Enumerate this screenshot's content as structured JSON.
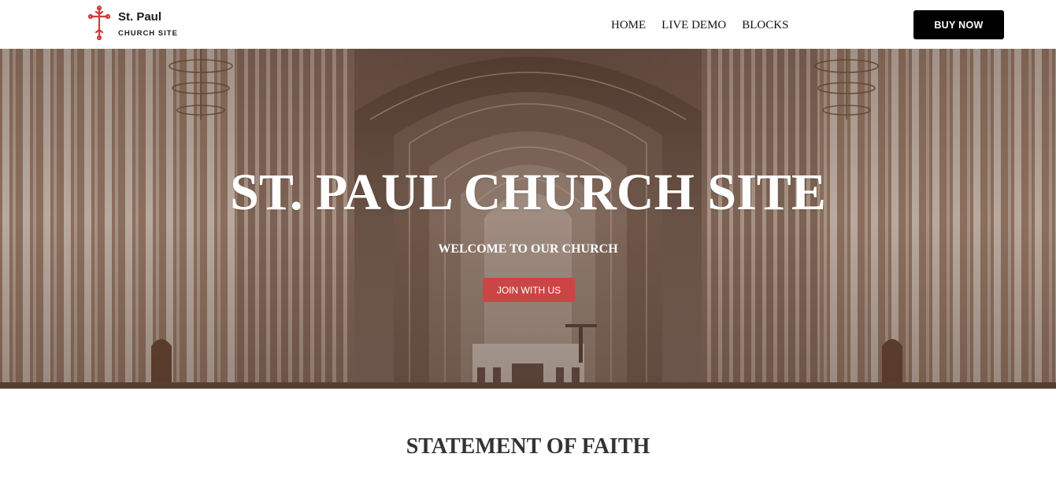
{
  "header": {
    "logo": {
      "name": "St. Paul",
      "subtitle": "CHURCH SITE",
      "icon": "cross-icon",
      "icon_color": "#d0393b"
    },
    "nav": [
      {
        "label": "HOME"
      },
      {
        "label": "LIVE DEMO"
      },
      {
        "label": "BLOCKS"
      }
    ],
    "buy_button": "BUY NOW"
  },
  "hero": {
    "title": "ST. PAUL CHURCH SITE",
    "subtitle": "WELCOME TO OUR CHURCH",
    "cta": "JOIN WITH US",
    "cta_color": "#cc4545"
  },
  "statement": {
    "title": "STATEMENT OF FAITH"
  }
}
